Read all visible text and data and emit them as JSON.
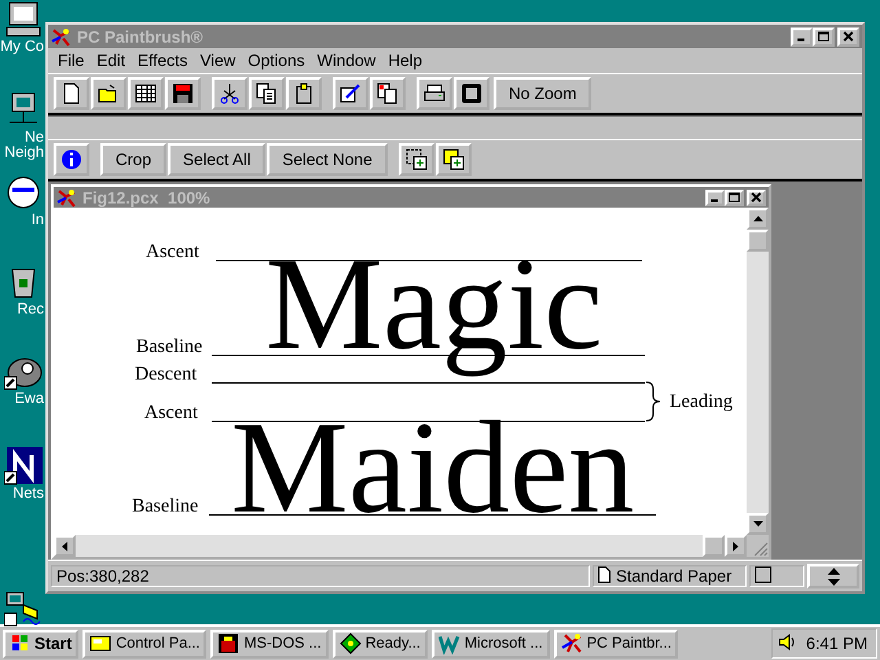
{
  "desktop_icons": [
    {
      "label": "My Co",
      "kind": "computer"
    },
    {
      "label": "Ne",
      "kind": "network"
    },
    {
      "label": "Neigh",
      "kind": "none"
    },
    {
      "label": "In",
      "kind": "globe"
    },
    {
      "label": "Rec",
      "kind": "bin"
    },
    {
      "label": "Ewa",
      "kind": "phone"
    },
    {
      "label": "Nets",
      "kind": "nets"
    }
  ],
  "window": {
    "title": "PC Paintbrush®",
    "menu": [
      "File",
      "Edit",
      "Effects",
      "View",
      "Options",
      "Window",
      "Help"
    ],
    "toolbar": [
      {
        "kind": "new"
      },
      {
        "kind": "open"
      },
      {
        "kind": "grid"
      },
      {
        "kind": "save"
      },
      {
        "kind": "gap"
      },
      {
        "kind": "cut"
      },
      {
        "kind": "copy"
      },
      {
        "kind": "paste"
      },
      {
        "kind": "gap"
      },
      {
        "kind": "edit"
      },
      {
        "kind": "clone"
      },
      {
        "kind": "gap"
      },
      {
        "kind": "print"
      },
      {
        "kind": "frame"
      },
      {
        "kind": "text",
        "label": "No Zoom"
      }
    ],
    "toolbar2": [
      {
        "kind": "info"
      },
      {
        "kind": "gap"
      },
      {
        "kind": "text",
        "label": "Crop"
      },
      {
        "kind": "text",
        "label": "Select All"
      },
      {
        "kind": "text",
        "label": "Select None"
      },
      {
        "kind": "gap"
      },
      {
        "kind": "addsel"
      },
      {
        "kind": "addpaste"
      }
    ],
    "document": {
      "title": "Fig12.pcx  100%",
      "figure": {
        "labels": [
          "Ascent",
          "Baseline",
          "Descent",
          "Ascent",
          "Baseline"
        ],
        "words": [
          "Magic",
          "Maiden"
        ],
        "bracket_label": "Leading"
      }
    },
    "status_bar": {
      "position": "Pos:380,282",
      "paper": "Standard Paper"
    }
  },
  "taskbar": {
    "start": "Start",
    "tasks": [
      {
        "label": "Control Pa...",
        "kind": "control"
      },
      {
        "label": "MS-DOS ...",
        "kind": "dos"
      },
      {
        "label": "Ready...",
        "kind": "ready"
      },
      {
        "label": "Microsoft ...",
        "kind": "word"
      },
      {
        "label": "PC Paintbr...",
        "kind": "paint"
      }
    ],
    "clock": "6:41 PM"
  }
}
